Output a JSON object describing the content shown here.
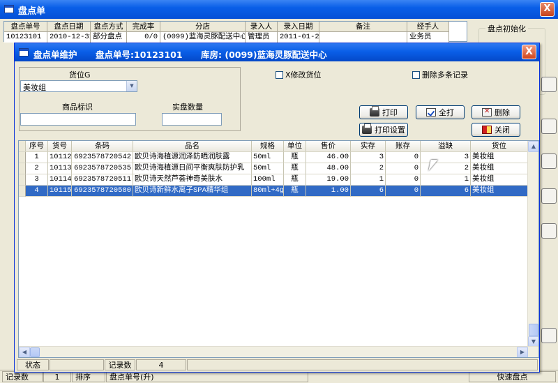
{
  "background_window": {
    "title": "盘点单",
    "close_label": "X",
    "table": {
      "columns": [
        "盘点单号",
        "盘点日期",
        "盘点方式",
        "完成率",
        "分店",
        "录入人",
        "录入日期",
        "备注",
        "经手人"
      ],
      "row": [
        "10123101",
        "2010-12-31",
        "部分盘点",
        "0/0",
        "(0099)蓝海灵豚配送中心",
        "管理员",
        "2011-01-27",
        "",
        "业务员"
      ]
    },
    "group_label": "盘点初始化",
    "status": [
      "记录数",
      "1",
      "排序",
      "盘点单号(升)",
      "快速盘点"
    ]
  },
  "dialog": {
    "title": "盘点单维护",
    "order_label": "盘点单号:10123101",
    "store_label": "库房: (0099)蓝海灵豚配送中心",
    "close_label": "X",
    "location_label": "货位G",
    "location_value": "美妆组",
    "product_id_label": "商品标识",
    "product_id_value": "",
    "actual_qty_label": "实盘数量",
    "actual_qty_value": "",
    "chk_modify_location": "X修改货位",
    "chk_delete_multiple": "删除多条记录",
    "buttons": {
      "print": "打印",
      "print_all": "全打",
      "delete": "删除",
      "print_settings": "打印设置",
      "close": "关闭"
    },
    "columns": [
      "序号",
      "货号",
      "条码",
      "品名",
      "规格",
      "单位",
      "售价",
      "实存",
      "账存",
      "溢缺",
      "货位"
    ],
    "rows": [
      [
        "1",
        "10112",
        "6923578720542",
        "欧贝诗海植源润泽防晒润肤露",
        "50ml",
        "瓶",
        "46.00",
        "3",
        "0",
        "3",
        "美妆组"
      ],
      [
        "2",
        "10113",
        "6923578720535",
        "欧贝诗海植源日间平衡爽肤防护乳",
        "50ml",
        "瓶",
        "48.00",
        "2",
        "0",
        "2",
        "美妆组"
      ],
      [
        "3",
        "10114",
        "6923578720511",
        "欧贝诗天然芦荟神奇美肤水",
        "100ml",
        "瓶",
        "19.00",
        "1",
        "0",
        "1",
        "美妆组"
      ],
      [
        "4",
        "10115",
        "6923578720580",
        "欧贝诗新鲜水离子SPA精华组",
        "80ml+4g",
        "瓶",
        "1.00",
        "6",
        "0",
        "6",
        "美妆组"
      ]
    ],
    "status": {
      "state_label": "状态",
      "state_value": "",
      "count_label": "记录数",
      "count_value": "4"
    }
  },
  "colors": {
    "titlebar": "#0a5fe8",
    "selection": "#316ac5",
    "face": "#ece9d8"
  }
}
